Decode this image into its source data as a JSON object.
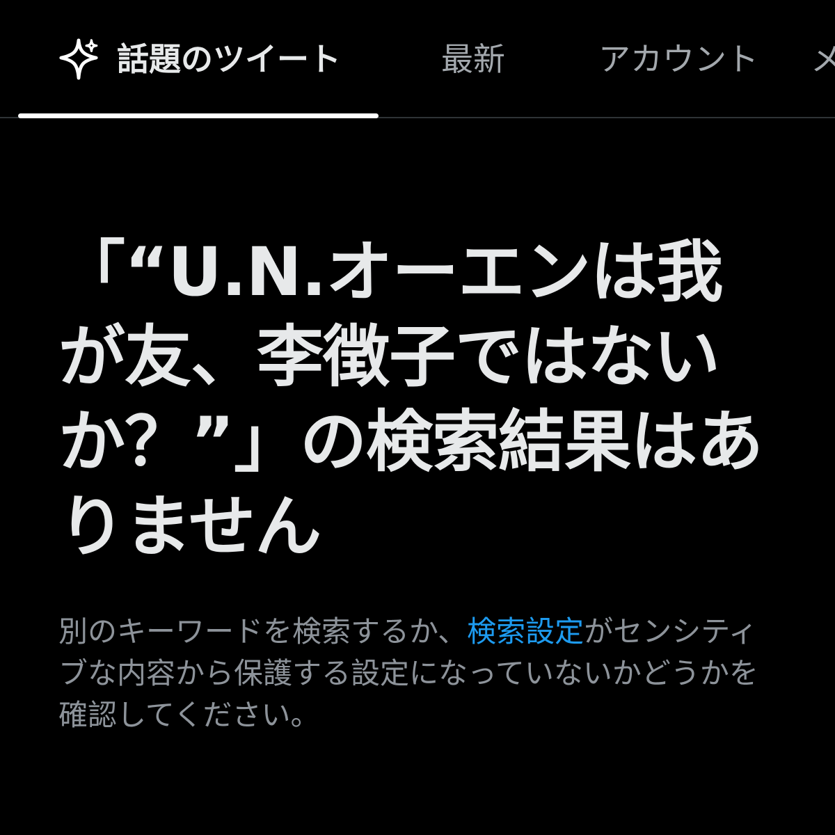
{
  "tabs": {
    "top": {
      "label": "話題のツイート",
      "icon": "sparkle-icon",
      "selected": true
    },
    "latest": {
      "label": "最新"
    },
    "accounts": {
      "label": "アカウント"
    },
    "next": {
      "label": "メ"
    }
  },
  "empty_state": {
    "title": "「“U.N.オーエンは我が友、李徴子ではないか？”」の検索結果はありません",
    "description_before": "別のキーワードを検索するか、",
    "link_text": "検索設定",
    "description_after": "がセンシティブな内容から保護する設定になっていないかどうかを確認してください。"
  },
  "colors": {
    "background": "#000000",
    "primary_text": "#e7e9ea",
    "secondary_text": "#8d939a",
    "link": "#1d9bf0",
    "indicator": "#ffffff"
  }
}
